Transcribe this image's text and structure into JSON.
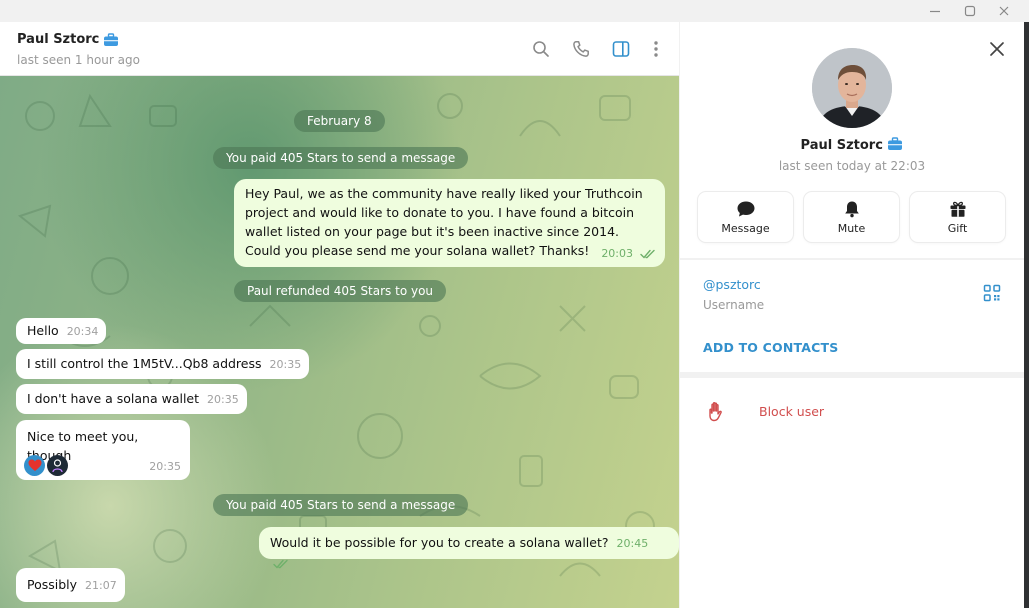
{
  "window": {
    "minimize": "minimize",
    "maximize": "maximize",
    "close": "close"
  },
  "chat": {
    "name": "Paul Sztorc",
    "status": "last seen 1 hour ago",
    "badge_icon": "briefcase-icon",
    "header_icons": [
      "search-icon",
      "phone-icon",
      "sidebar-toggle-icon",
      "more-vertical-icon"
    ]
  },
  "messages": {
    "date": "February 8",
    "service_paid_1": "You paid 405 Stars to send a message",
    "out_1": {
      "text": "Hey Paul, we as the community have really liked your Truthcoin project and would like to donate to you. I have found a bitcoin wallet listed on your page but it's been inactive since 2014. Could you please send me your solana wallet? Thanks!",
      "time": "20:03"
    },
    "service_refund": "Paul refunded 405 Stars to you",
    "in_1": {
      "text": "Hello",
      "time": "20:34"
    },
    "in_2": {
      "text": "I still control the 1M5tV...Qb8 address",
      "time": "20:35"
    },
    "in_3": {
      "text": "I don't have a solana wallet",
      "time": "20:35"
    },
    "in_4": {
      "text": "Nice to meet you, though",
      "time": "20:35",
      "reactions": [
        "heart-reaction-icon",
        "avatar-reaction-icon"
      ]
    },
    "service_paid_2": "You paid 405 Stars to send a message",
    "out_2": {
      "text": "Would it be possible for you to create a solana wallet?",
      "time": "20:45"
    },
    "in_5": {
      "text": "Possibly",
      "time": "21:07"
    }
  },
  "profile": {
    "name": "Paul Sztorc",
    "status": "last seen today at 22:03",
    "actions": [
      {
        "label": "Message",
        "icon": "message-bubble-icon"
      },
      {
        "label": "Mute",
        "icon": "bell-icon"
      },
      {
        "label": "Gift",
        "icon": "gift-icon"
      }
    ],
    "username": "@psztorc",
    "username_caption": "Username",
    "add_contacts": "ADD TO CONTACTS",
    "block_user": "Block user"
  },
  "colors": {
    "accent": "#3390cc",
    "outgoing_bubble": "#effdde",
    "danger": "#d14e4e",
    "read_check": "#6fb06a"
  }
}
